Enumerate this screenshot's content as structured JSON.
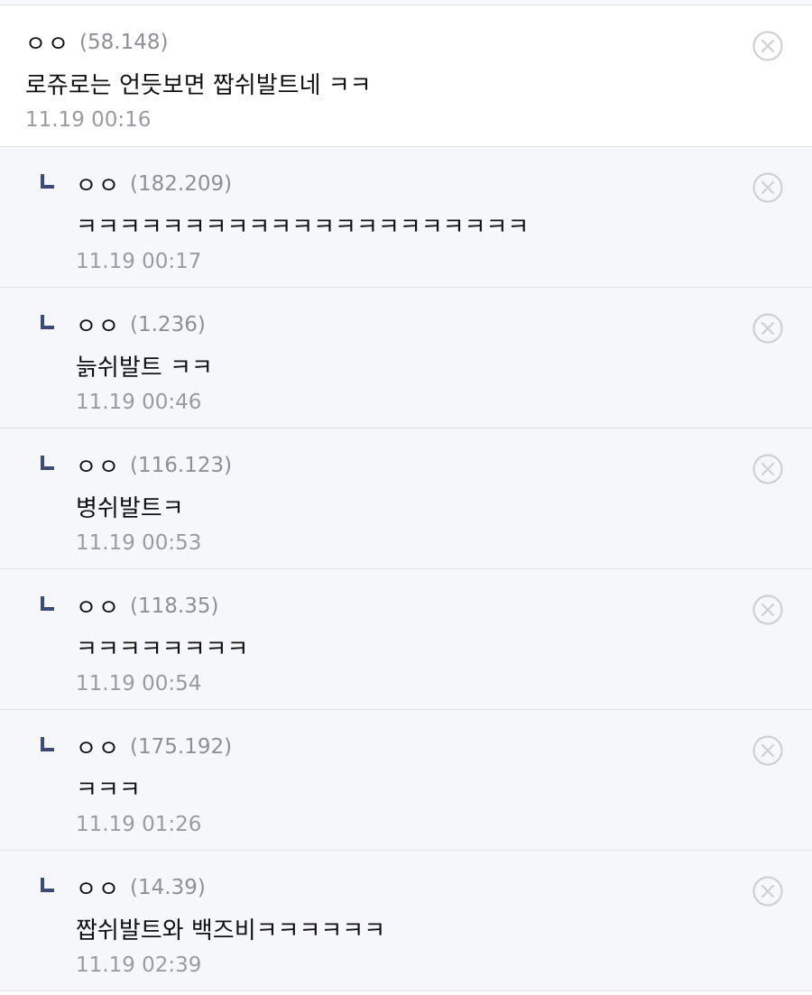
{
  "comments": [
    {
      "type": "root",
      "nickname": "ㅇㅇ",
      "ip": "(58.148)",
      "text": "로쥬로는 언듯보면 짭쉬발트네 ㅋㅋ",
      "time": "11.19 00:16"
    },
    {
      "type": "reply",
      "nickname": "ㅇㅇ",
      "ip": "(182.209)",
      "text": "ㅋㅋㅋㅋㅋㅋㅋㅋㅋㅋㅋㅋㅋㅋㅋㅋㅋㅋㅋㅋㅋ",
      "time": "11.19 00:17"
    },
    {
      "type": "reply",
      "nickname": "ㅇㅇ",
      "ip": "(1.236)",
      "text": "늙쉬발트 ㅋㅋ",
      "time": "11.19 00:46"
    },
    {
      "type": "reply",
      "nickname": "ㅇㅇ",
      "ip": "(116.123)",
      "text": "병쉬발트ㅋ",
      "time": "11.19 00:53"
    },
    {
      "type": "reply",
      "nickname": "ㅇㅇ",
      "ip": "(118.35)",
      "text": "ㅋㅋㅋㅋㅋㅋㅋㅋ",
      "time": "11.19 00:54"
    },
    {
      "type": "reply",
      "nickname": "ㅇㅇ",
      "ip": "(175.192)",
      "text": "ㅋㅋㅋ",
      "time": "11.19 01:26"
    },
    {
      "type": "reply",
      "nickname": "ㅇㅇ",
      "ip": "(14.39)",
      "text": "짭쉬발트와 백즈비ㅋㅋㅋㅋㅋㅋ",
      "time": "11.19 02:39"
    }
  ],
  "icons": {
    "reply": "reply-arrow-icon",
    "delete": "close-circle-icon"
  },
  "colors": {
    "reply_mark": "#3b4a7a",
    "delete_icon": "#cfd0d4",
    "ip_text": "#8f9095",
    "time_text": "#9a9ba0",
    "reply_bg": "#f6f7fa"
  }
}
